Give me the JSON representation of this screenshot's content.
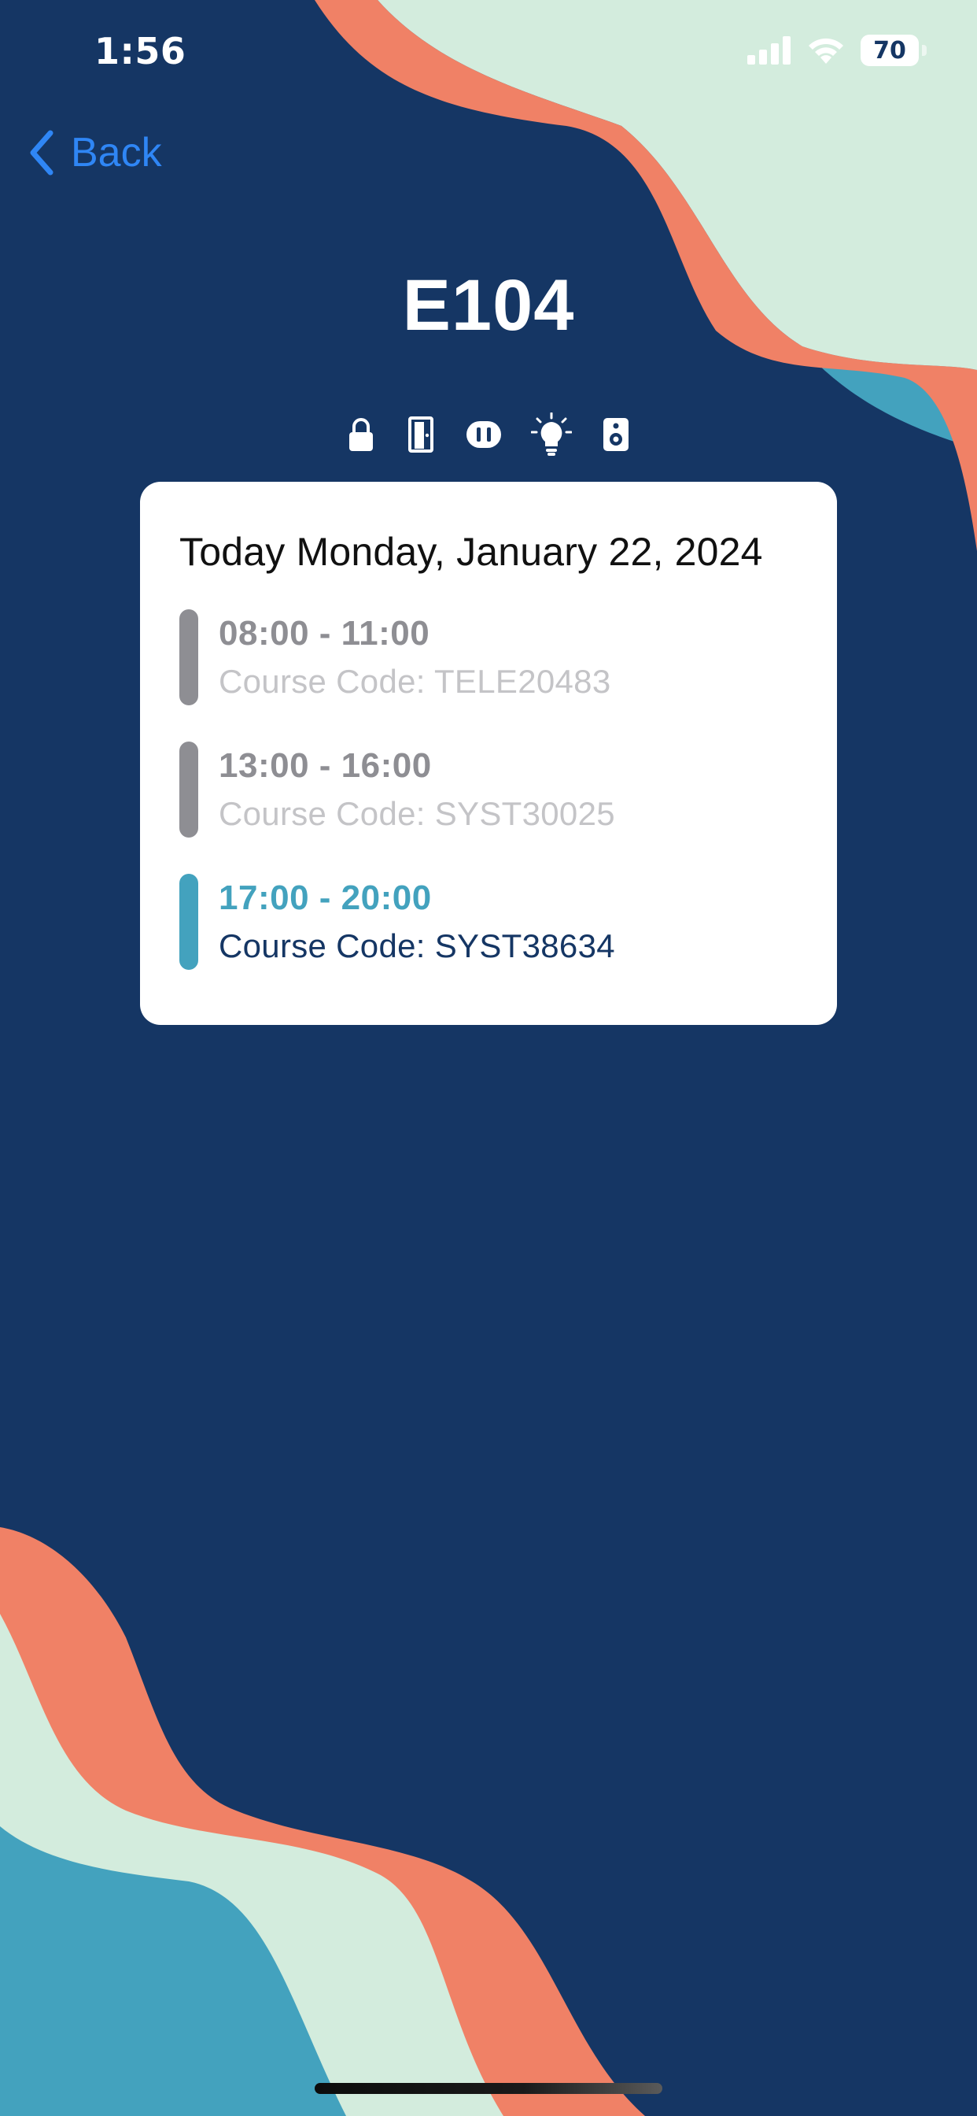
{
  "status_bar": {
    "time": "1:56",
    "battery": "70"
  },
  "nav": {
    "back_label": "Back"
  },
  "room": {
    "title": "E104",
    "amenities": [
      "lock-icon",
      "door-icon",
      "outlet-icon",
      "lightbulb-icon",
      "speaker-icon"
    ]
  },
  "schedule": {
    "date_heading": "Today Monday, January 22, 2024",
    "sessions": [
      {
        "time": "08:00 - 11:00",
        "course": "Course Code: TELE20483",
        "state": "past"
      },
      {
        "time": "13:00 - 16:00",
        "course": "Course Code: SYST30025",
        "state": "past"
      },
      {
        "time": "17:00 - 20:00",
        "course": "Course Code: SYST38634",
        "state": "current"
      }
    ]
  },
  "colors": {
    "background": "#153664",
    "coral": "#f08166",
    "mint": "#d3ecdd",
    "teal": "#43a2be",
    "link": "#2f86f5",
    "past_gray": "#8e8e93"
  }
}
